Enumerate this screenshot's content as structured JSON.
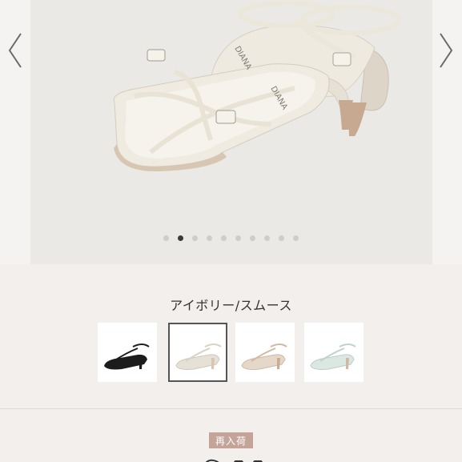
{
  "gallery": {
    "dot_count": 10,
    "active_index": 1,
    "prev_icon": "chevron-left-icon",
    "next_icon": "chevron-right-icon"
  },
  "variant": {
    "selected_label": "アイボリー/スムース",
    "swatches": [
      {
        "name": "black",
        "color": "#1c1c1c"
      },
      {
        "name": "ivory",
        "color": "#ece8df"
      },
      {
        "name": "beige",
        "color": "#d8c6b4"
      },
      {
        "name": "mint",
        "color": "#c9dad2"
      }
    ]
  },
  "status": {
    "badge": "再入荷",
    "badge_color": "#c4a399"
  }
}
